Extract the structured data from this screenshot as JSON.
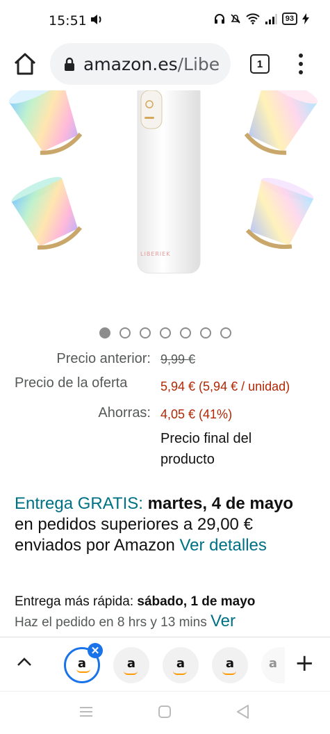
{
  "status_bar": {
    "time": "15:51",
    "battery": "93"
  },
  "browser": {
    "url_domain": "amazon.es",
    "url_path": "/Libe",
    "tab_count": "1"
  },
  "product": {
    "carousel_total": 7,
    "carousel_active": 1,
    "brand_on_device": "LIBERIEK"
  },
  "pricing": {
    "previous_label": "Precio anterior:",
    "previous_value": "9,99 €",
    "deal_label": "Precio de la oferta",
    "deal_value": "5,94 € (5,94 € / unidad)",
    "savings_label": "Ahorras:",
    "savings_value": "4,05 € (41%)",
    "final_note": "Precio final del producto"
  },
  "delivery": {
    "free_label": "Entrega GRATIS:",
    "free_date": "martes, 4 de mayo",
    "free_condition": "en pedidos superiores a 29,00 € enviados por Amazon",
    "details_link": "Ver detalles",
    "fast_label": "Entrega más rápida:",
    "fast_date": "sábado, 1 de mayo",
    "fast_order_by": "Haz el pedido en 8 hrs y 13 mins",
    "fast_link": "Ver"
  },
  "tab_strip": {
    "tab_letter": "a",
    "colors": {
      "active_ring": "#1a73e8",
      "amazon_orange": "#ff9900"
    }
  },
  "colors": {
    "price_red": "#B12704",
    "link_teal": "#007185",
    "muted_gray": "#565959"
  }
}
